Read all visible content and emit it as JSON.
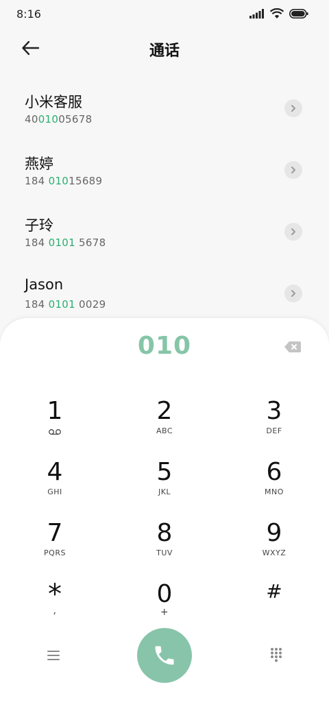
{
  "status": {
    "time": "8:16"
  },
  "header": {
    "title": "通话"
  },
  "contacts": [
    {
      "name": "小米客服",
      "number_parts": [
        "40",
        "010",
        "05678"
      ]
    },
    {
      "name": "燕婷",
      "number_parts": [
        "184 ",
        "010",
        "15689"
      ]
    },
    {
      "name": "子玲",
      "number_parts": [
        "184 ",
        "0101",
        " 5678"
      ]
    },
    {
      "name": "Jason",
      "number_parts": [
        "184 ",
        "0101",
        " 0029"
      ]
    }
  ],
  "dialpad": {
    "input": "010",
    "keys": [
      {
        "digit": "1",
        "letters": ""
      },
      {
        "digit": "2",
        "letters": "ABC"
      },
      {
        "digit": "3",
        "letters": "DEF"
      },
      {
        "digit": "4",
        "letters": "GHI"
      },
      {
        "digit": "5",
        "letters": "JKL"
      },
      {
        "digit": "6",
        "letters": "MNO"
      },
      {
        "digit": "7",
        "letters": "PQRS"
      },
      {
        "digit": "8",
        "letters": "TUV"
      },
      {
        "digit": "9",
        "letters": "WXYZ"
      },
      {
        "digit": "*",
        "letters": ","
      },
      {
        "digit": "0",
        "letters": "+"
      },
      {
        "digit": "#",
        "letters": ""
      }
    ]
  },
  "colors": {
    "highlight": "#2cae6f",
    "call": "#88c4aa",
    "input": "#86c5a8"
  },
  "icons": {
    "back": "arrow-left-icon",
    "chevron": "chevron-right-icon",
    "backspace": "backspace-icon",
    "voicemail": "voicemail-icon",
    "menu": "menu-icon",
    "call": "phone-icon",
    "keypad": "dialpad-grid-icon"
  }
}
